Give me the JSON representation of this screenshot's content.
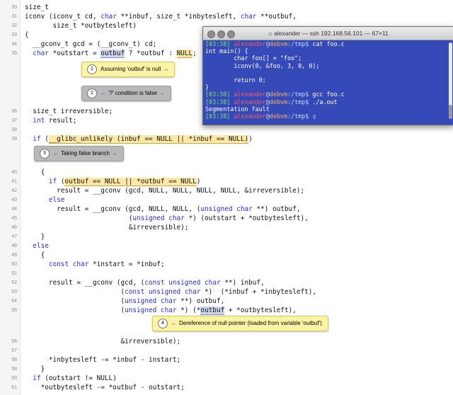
{
  "lines": [
    {
      "no": "30",
      "text": "size_t"
    },
    {
      "no": "31",
      "text": "iconv (iconv_t cd, char **inbuf, size_t *inbytesleft, char **outbuf,"
    },
    {
      "no": "32",
      "text": "       size_t *outbytesleft)"
    },
    {
      "no": "33",
      "text": "{"
    },
    {
      "no": "34",
      "text": "  __gconv_t gcd = (__gconv_t) cd;"
    },
    {
      "no": "35",
      "text": "  char *outstart = outbuf ? *outbuf : NULL;"
    },
    {
      "no": "36",
      "text": "  size_t irreversible;"
    },
    {
      "no": "37",
      "text": "  int result;"
    },
    {
      "no": "38",
      "text": ""
    },
    {
      "no": "39",
      "text": "  if (__glibc_unlikely (inbuf == NULL || *inbuf == NULL))"
    },
    {
      "no": "40",
      "text": "    {"
    },
    {
      "no": "41",
      "text": "      if (outbuf == NULL || *outbuf == NULL)"
    },
    {
      "no": "42",
      "text": "        result = __gconv (gcd, NULL, NULL, NULL, NULL, &irreversible);"
    },
    {
      "no": "43",
      "text": "      else"
    },
    {
      "no": "44",
      "text": "        result = __gconv (gcd, NULL, NULL, (unsigned char **) outbuf,"
    },
    {
      "no": "45",
      "text": "                          (unsigned char *) (outstart + *outbytesleft),"
    },
    {
      "no": "46",
      "text": "                          &irreversible);"
    },
    {
      "no": "47",
      "text": "    }"
    },
    {
      "no": "48",
      "text": "  else"
    },
    {
      "no": "49",
      "text": "    {"
    },
    {
      "no": "50",
      "text": "      const char *instart = *inbuf;"
    },
    {
      "no": "51",
      "text": ""
    },
    {
      "no": "52",
      "text": "      result = __gconv (gcd, (const unsigned char **) inbuf,"
    },
    {
      "no": "53",
      "text": "                        (const unsigned char *)  (*inbuf + *inbytesleft),"
    },
    {
      "no": "54",
      "text": "                        (unsigned char **) outbuf,"
    },
    {
      "no": "55",
      "text": "                        (unsigned char *) (*outbuf + *outbytesleft),"
    },
    {
      "no": "56",
      "text": "                        &irreversible);"
    },
    {
      "no": "57",
      "text": ""
    },
    {
      "no": "58",
      "text": "      *inbytesleft -= *inbuf - instart;"
    },
    {
      "no": "59",
      "text": "    }"
    },
    {
      "no": "60",
      "text": "  if (outstart != NULL)"
    },
    {
      "no": "61",
      "text": "    *outbytesleft -= *outbuf - outstart;"
    }
  ],
  "notes": [
    {
      "num": "1",
      "text": "Assuming 'outbuf' is null",
      "arrow_right": "→",
      "style": "yellow"
    },
    {
      "num": "2",
      "text": "'?' condition is false",
      "arrow_left": "←",
      "arrow_right": "→",
      "style": "gray"
    },
    {
      "num": "3",
      "text": "Taking false branch",
      "arrow_left": "←",
      "arrow_right": "→",
      "style": "gray"
    },
    {
      "num": "4",
      "text": "Dereference of null pointer (loaded from variable 'outbuf')",
      "arrow_left": "←",
      "style": "yellow"
    }
  ],
  "terminal": {
    "title": "alexander — ssh 192.168.56.101 — 67×11",
    "home_icon": "⌂",
    "prompt_time": "[03:38]",
    "prompt_user": "alexander",
    "prompt_at": "@",
    "prompt_host": "debvm",
    "prompt_path": ":/tmp$",
    "cmd1": "cat foo.c",
    "out1": "int main() {\n        char foo[] = \"foo\";\n        iconv(0, &foo, 3, 0, 0);\n\n        return 0;\n}",
    "cmd2": "gcc foo.c",
    "cmd3": "./a.out",
    "out3": "Segmentation fault",
    "cursor": "▯"
  },
  "colors": {
    "keyword": "#2a2ad0",
    "highlight": "#fde8a6",
    "terminal_bg": "#3649b9"
  }
}
